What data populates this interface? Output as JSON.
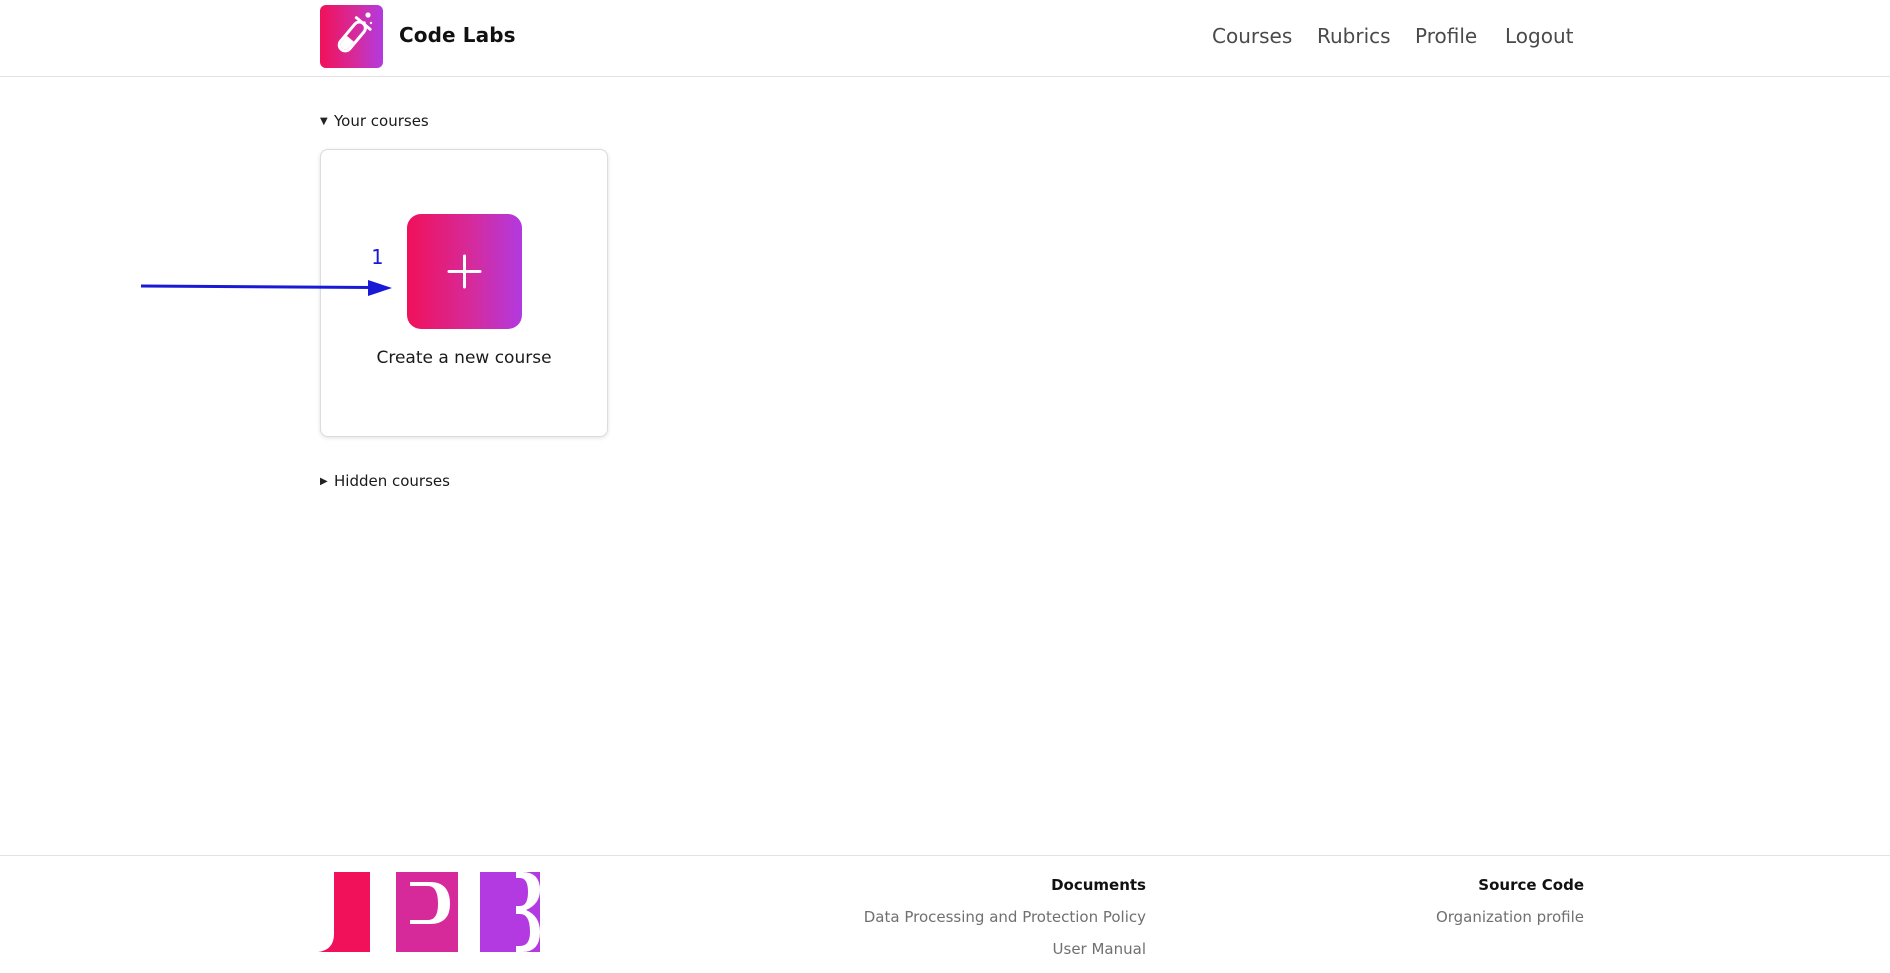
{
  "header": {
    "brand": "Code Labs",
    "nav": [
      "Courses",
      "Rubrics",
      "Profile",
      "Logout"
    ]
  },
  "main": {
    "your_courses_label": "Your courses",
    "create_course_label": "Create a new course",
    "hidden_courses_label": "Hidden courses"
  },
  "annotation": {
    "step_number": "1"
  },
  "footer": {
    "logo_text": "UPB",
    "documents_heading": "Documents",
    "documents_links": [
      "Data Processing and Protection Policy",
      "User Manual"
    ],
    "source_heading": "Source Code",
    "source_links": [
      "Organization profile"
    ]
  },
  "colors": {
    "brand_gradient_start": "#f0115a",
    "brand_gradient_end": "#b23ae0",
    "annotation_blue": "#1a1ad6"
  }
}
